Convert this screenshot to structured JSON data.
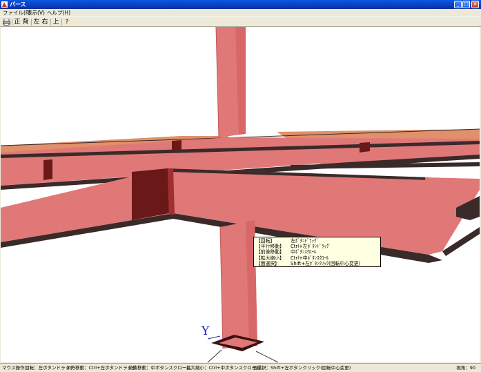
{
  "window": {
    "title": "パース"
  },
  "menu": [
    {
      "label": "ファイル(F)"
    },
    {
      "label": "表示(V)"
    },
    {
      "label": "ヘルプ(H)"
    }
  ],
  "toolbar": {
    "front": "正",
    "back": "背",
    "left": "左",
    "right": "右",
    "top": "上",
    "print_icon": "printer-icon",
    "help_icon": "question-icon"
  },
  "axis_label": "Y",
  "tooltip": [
    {
      "key": "【回転】",
      "value": "左ﾎﾞﾀﾝﾄﾞﾗｯｸﾞ"
    },
    {
      "key": "【平行移動】",
      "value": "Ctrl+左ﾎﾞﾀﾝﾄﾞﾗｯｸﾞ"
    },
    {
      "key": "【前後移動】",
      "value": "中ﾎﾞﾀﾝｽｸﾛｰﾙ"
    },
    {
      "key": "【拡大縮小】",
      "value": "Ctrl+中ﾎﾞﾀﾝｽｸﾛｰﾙ"
    },
    {
      "key": "【面選択】",
      "value": "Shift+左ﾎﾞﾀﾝｸﾘｯｸ(回転中心変更)"
    }
  ],
  "status": {
    "mouse": "マウス操作",
    "rotate": "回転：左ボタンドラッグ",
    "pan": "平行移動：Ctrl+左ボタンドラッグ",
    "dolly": "前後移動：中ボタンスクロール",
    "zoom": "拡大縮小：Ctrl+中ボタンスクロール",
    "select": "面選択：Shift+左ボタンクリック(回転中心変更)",
    "view_angle": "視角：90"
  },
  "colors": {
    "steel": "#e07878",
    "steel_dark": "#6a1818",
    "steel_edge": "#3a2a2a",
    "beam_orange": "#e0906a"
  }
}
